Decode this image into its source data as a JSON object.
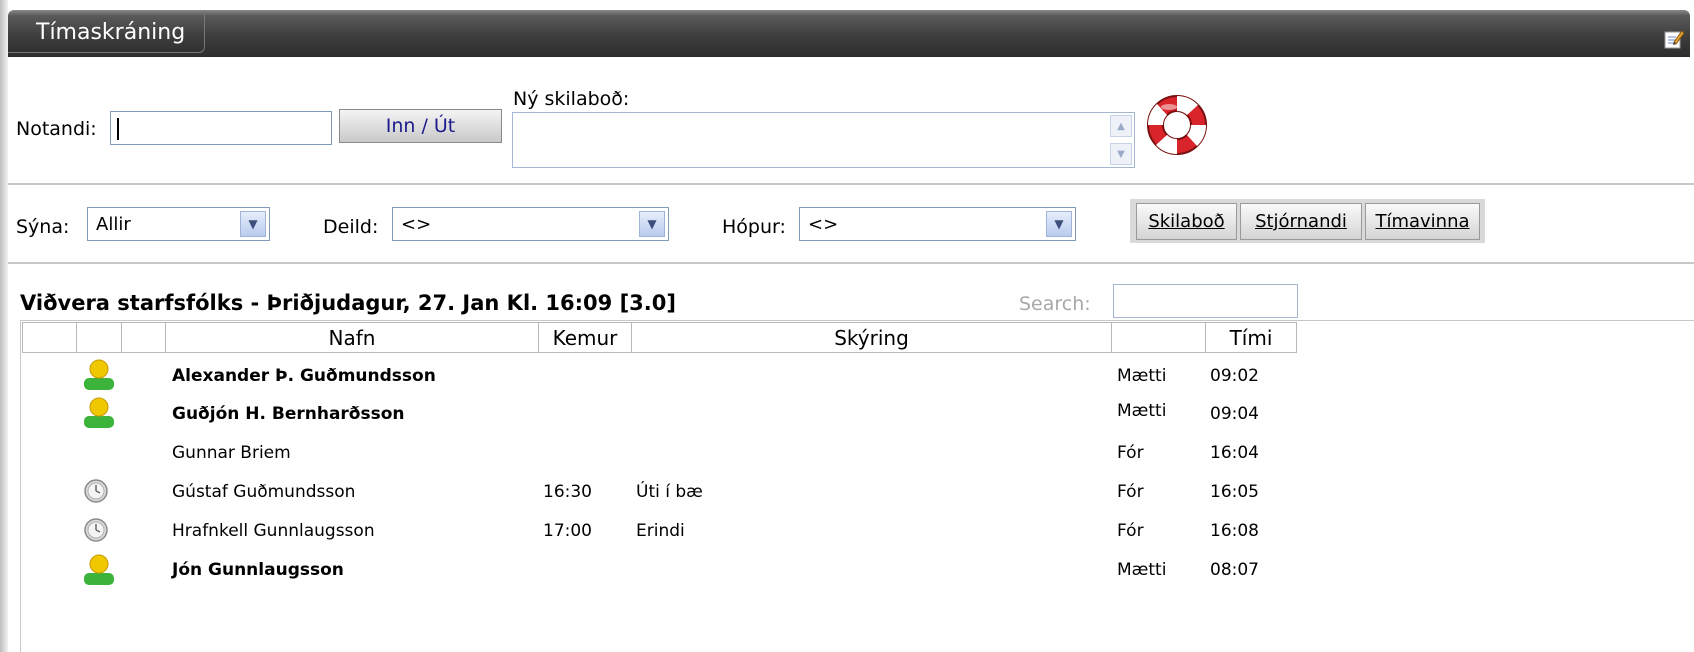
{
  "window": {
    "title": "Tímaskráning"
  },
  "entry": {
    "user_label": "Notandi:",
    "user_value": "",
    "inout_button": "Inn / Út",
    "message_label": "Ný skilaboð:",
    "message_value": ""
  },
  "filters": {
    "show_label": "Sýna:",
    "show_value": "Allir",
    "dept_label": "Deild:",
    "dept_value": "<>",
    "group_label": "Hópur:",
    "group_value": "<>"
  },
  "tabs": [
    "Skilaboð",
    "Stjórnandi",
    "Tímavinna"
  ],
  "panel": {
    "title": "Viðvera starfsfólks - Þriðjudagur, 27. Jan Kl. 16:09 [3.0]",
    "search_label": "Search:",
    "search_value": ""
  },
  "table": {
    "columns": [
      "",
      "",
      "",
      "Nafn",
      "Kemur",
      "Skýring",
      "",
      "Tími"
    ],
    "rows": [
      {
        "icon": "user-present-icon",
        "name": "Alexander Þ. Guðmundsson",
        "bold": true,
        "kemur": "",
        "skyring": "",
        "status": "Mætti",
        "time": "09:02"
      },
      {
        "icon": "user-present-icon",
        "name": "Guðjón H. Bernharðsson",
        "bold": true,
        "kemur": "",
        "skyring": "",
        "status": "Mætti",
        "time": "09:04"
      },
      {
        "icon": "",
        "name": "Gunnar Briem",
        "bold": false,
        "kemur": "",
        "skyring": "",
        "status": "Fór",
        "time": "16:04"
      },
      {
        "icon": "clock-icon",
        "name": "Gústaf Guðmundsson",
        "bold": false,
        "kemur": "16:30",
        "skyring": "Úti í bæ",
        "status": "Fór",
        "time": "16:05"
      },
      {
        "icon": "clock-icon",
        "name": "Hrafnkell Gunnlaugsson",
        "bold": false,
        "kemur": "17:00",
        "skyring": "Erindi",
        "status": "Fór",
        "time": "16:08"
      },
      {
        "icon": "user-present-icon",
        "name": "Jón Gunnlaugsson",
        "bold": true,
        "kemur": "",
        "skyring": "",
        "status": "Mætti",
        "time": "08:07"
      }
    ]
  },
  "colors": {
    "titlebar": "#3e3e3e",
    "accent": "#1a1a8a",
    "present": "#3cb43c",
    "present_head": "#f0c800"
  }
}
